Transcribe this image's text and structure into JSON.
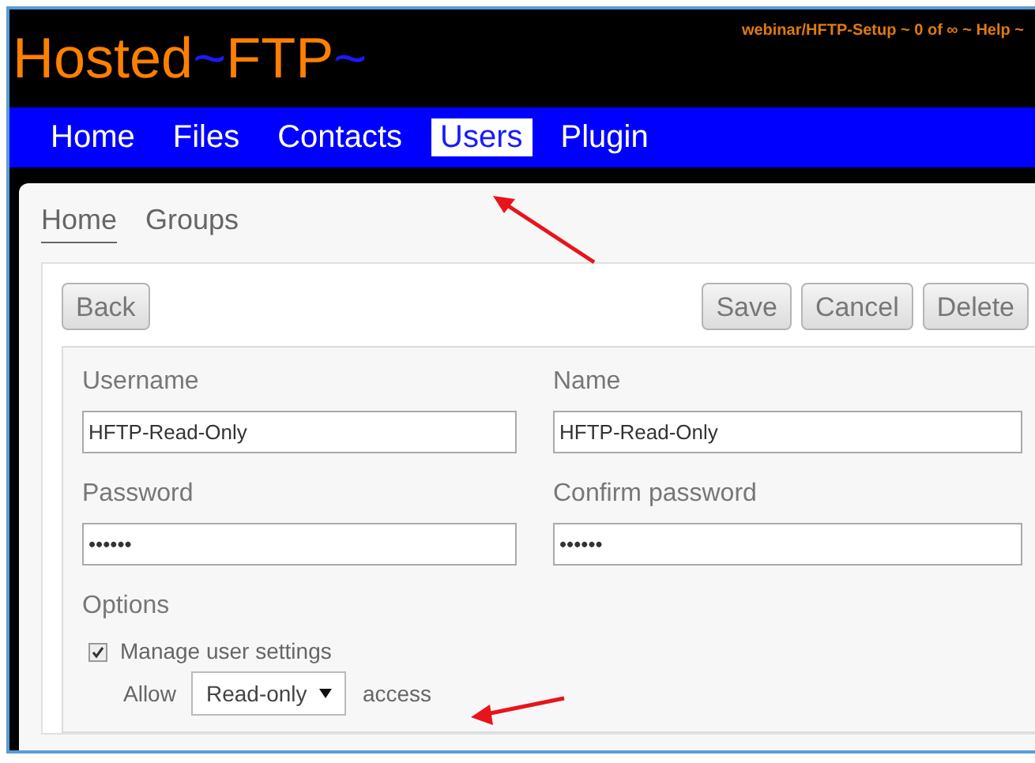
{
  "logo": {
    "parts": [
      {
        "text": "Hosted",
        "kind": "word"
      },
      {
        "text": "~",
        "kind": "tilde"
      },
      {
        "text": "FTP",
        "kind": "word"
      },
      {
        "text": "~",
        "kind": "tilde"
      }
    ]
  },
  "account_line": "webinar/HFTP-Setup ~ 0 of ∞ ~ Help ~",
  "nav": [
    {
      "label": "Home",
      "selected": false
    },
    {
      "label": "Files",
      "selected": false
    },
    {
      "label": "Contacts",
      "selected": false
    },
    {
      "label": "Users",
      "selected": true
    },
    {
      "label": "Plugin",
      "selected": false
    }
  ],
  "subnav": [
    {
      "label": "Home",
      "selected": true
    },
    {
      "label": "Groups",
      "selected": false
    }
  ],
  "toolbar": {
    "left": [
      "Back"
    ],
    "right": [
      "Save",
      "Cancel",
      "Delete"
    ]
  },
  "fields": [
    {
      "label": "Username",
      "value": "HFTP-Read-Only"
    },
    {
      "label": "Name",
      "value": "HFTP-Read-Only"
    },
    {
      "label": "Password",
      "value": "••••••"
    },
    {
      "label": "Confirm password",
      "value": "••••••"
    }
  ],
  "options": {
    "title": "Options",
    "checkbox": {
      "label": "Manage user settings",
      "checked": true
    },
    "access": {
      "prefix": "Allow",
      "value": "Read-only",
      "suffix": "access"
    }
  }
}
